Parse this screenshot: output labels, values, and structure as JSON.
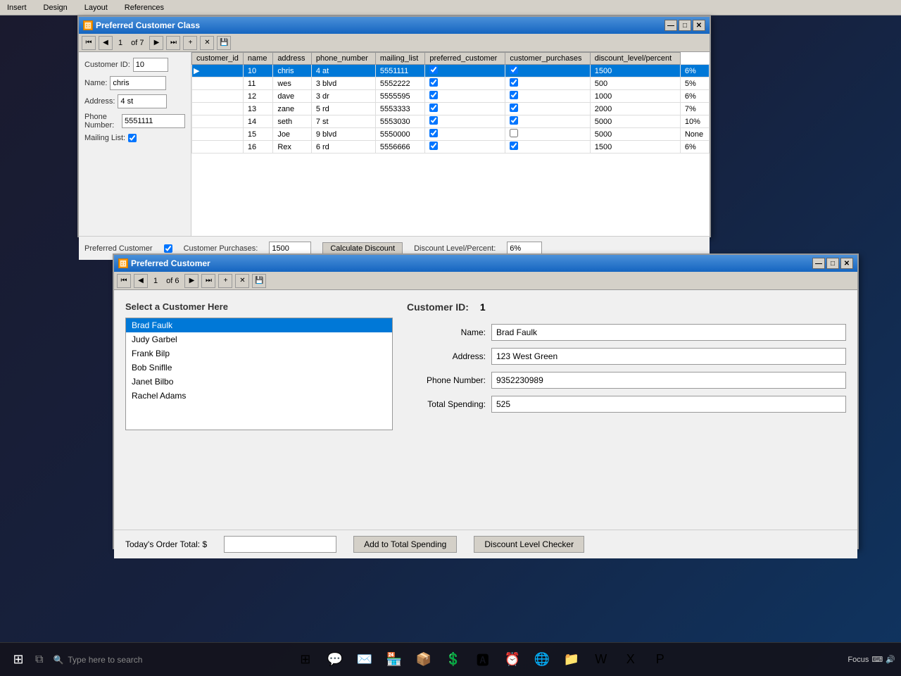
{
  "menubar": {
    "items": [
      "Insert",
      "Design",
      "Layout",
      "References"
    ]
  },
  "upper_window": {
    "title": "Preferred Customer Class",
    "nav": {
      "record_current": "1",
      "record_total": "of 7"
    },
    "left_panel": {
      "customer_id_label": "Customer ID:",
      "customer_id_value": "10",
      "name_label": "Name:",
      "name_value": "chris",
      "address_label": "Address:",
      "address_value": "4 st",
      "phone_label": "Phone Number:",
      "phone_value": "5551111",
      "mailing_label": "Mailing List:"
    },
    "table": {
      "headers": [
        "customer_id",
        "name",
        "address",
        "phone_number",
        "mailing_list",
        "preferred_customer",
        "customer_purchases",
        "discount_level/percent"
      ],
      "rows": [
        {
          "id": "10",
          "name": "chris",
          "address": "4 at",
          "phone": "5551111",
          "mailing": true,
          "preferred": true,
          "purchases": "1500",
          "discount": "6%",
          "selected": true
        },
        {
          "id": "11",
          "name": "wes",
          "address": "3 blvd",
          "phone": "5552222",
          "mailing": true,
          "preferred": true,
          "purchases": "500",
          "discount": "5%",
          "selected": false
        },
        {
          "id": "12",
          "name": "dave",
          "address": "3 dr",
          "phone": "5555595",
          "mailing": true,
          "preferred": true,
          "purchases": "1000",
          "discount": "6%",
          "selected": false
        },
        {
          "id": "13",
          "name": "zane",
          "address": "5 rd",
          "phone": "5553333",
          "mailing": true,
          "preferred": true,
          "purchases": "2000",
          "discount": "7%",
          "selected": false
        },
        {
          "id": "14",
          "name": "seth",
          "address": "7 st",
          "phone": "5553030",
          "mailing": true,
          "preferred": true,
          "purchases": "5000",
          "discount": "10%",
          "selected": false
        },
        {
          "id": "15",
          "name": "Joe",
          "address": "9 blvd",
          "phone": "5550000",
          "mailing": true,
          "preferred": false,
          "purchases": "5000",
          "discount": "None",
          "selected": false
        },
        {
          "id": "16",
          "name": "Rex",
          "address": "6 rd",
          "phone": "5556666",
          "mailing": true,
          "preferred": true,
          "purchases": "1500",
          "discount": "6%",
          "selected": false
        }
      ]
    },
    "bottom": {
      "preferred_label": "Preferred Customer",
      "purchases_label": "Customer Purchases:",
      "purchases_value": "1500",
      "calculate_btn": "Calculate Discount",
      "discount_label": "Discount Level/Percent:",
      "discount_value": "6%"
    }
  },
  "lower_window": {
    "title": "Preferred Customer",
    "nav": {
      "record_current": "1",
      "record_total": "of 6"
    },
    "select_label": "Select a Customer Here",
    "customers": [
      {
        "name": "Brad Faulk",
        "selected": true
      },
      {
        "name": "Judy Garbel",
        "selected": false
      },
      {
        "name": "Frank Bilp",
        "selected": false
      },
      {
        "name": "Bob Sniflle",
        "selected": false
      },
      {
        "name": "Janet Bilbo",
        "selected": false
      },
      {
        "name": "Rachel Adams",
        "selected": false
      }
    ],
    "customer_id_label": "Customer ID:",
    "customer_id_value": "1",
    "fields": {
      "name_label": "Name:",
      "name_value": "Brad Faulk",
      "address_label": "Address:",
      "address_value": "123 West Green",
      "phone_label": "Phone Number:",
      "phone_value": "9352230989",
      "spending_label": "Total Spending:",
      "spending_value": "525"
    },
    "bottom": {
      "order_total_label": "Today's Order Total:  $",
      "order_total_value": "",
      "add_btn": "Add to Total Spending",
      "discount_btn": "Discount Level Checker"
    }
  },
  "taskbar": {
    "search_placeholder": "Type here to search",
    "system_text": "Focus"
  },
  "icons": {
    "db": "🗄",
    "minimize": "—",
    "maximize": "□",
    "close": "✕",
    "first": "⏮",
    "prev": "◀",
    "next": "▶",
    "last": "⏭",
    "add": "+",
    "delete": "✕",
    "save": "💾"
  }
}
